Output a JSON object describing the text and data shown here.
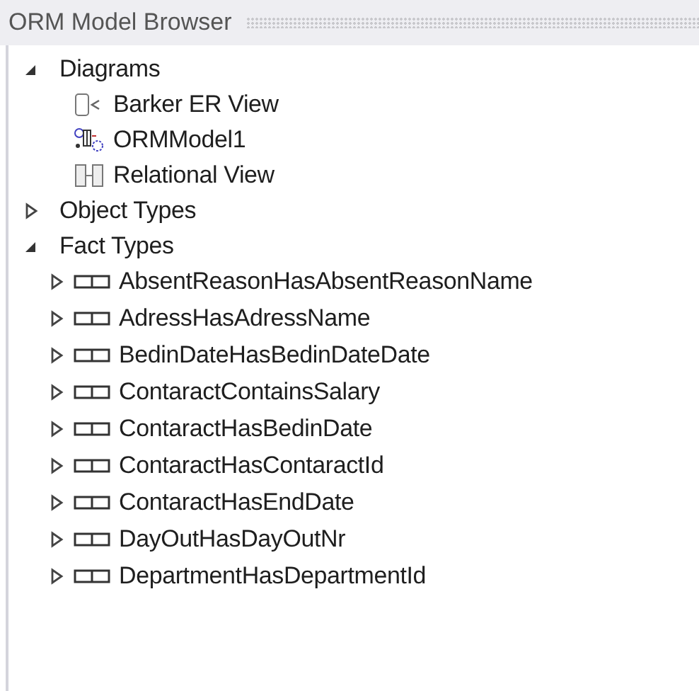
{
  "panel": {
    "title": "ORM Model Browser"
  },
  "tree": [
    {
      "label": "Diagrams",
      "expanded": true,
      "children": [
        {
          "label": "Barker ER View",
          "kind": "barker"
        },
        {
          "label": "ORMModel1",
          "kind": "orm"
        },
        {
          "label": "Relational View",
          "kind": "relational"
        }
      ]
    },
    {
      "label": "Object Types",
      "expanded": false
    },
    {
      "label": "Fact Types",
      "expanded": true,
      "children": [
        {
          "label": "AbsentReasonHasAbsentReasonName",
          "kind": "fact",
          "expanded": false
        },
        {
          "label": "AdressHasAdressName",
          "kind": "fact",
          "expanded": false
        },
        {
          "label": "BedinDateHasBedinDateDate",
          "kind": "fact",
          "expanded": false
        },
        {
          "label": "ContaractContainsSalary",
          "kind": "fact",
          "expanded": false
        },
        {
          "label": "ContaractHasBedinDate",
          "kind": "fact",
          "expanded": false
        },
        {
          "label": "ContaractHasContaractId",
          "kind": "fact",
          "expanded": false
        },
        {
          "label": "ContaractHasEndDate",
          "kind": "fact",
          "expanded": false
        },
        {
          "label": "DayOutHasDayOutNr",
          "kind": "fact",
          "expanded": false
        },
        {
          "label": "DepartmentHasDepartmentId",
          "kind": "fact",
          "expanded": false
        }
      ]
    }
  ]
}
